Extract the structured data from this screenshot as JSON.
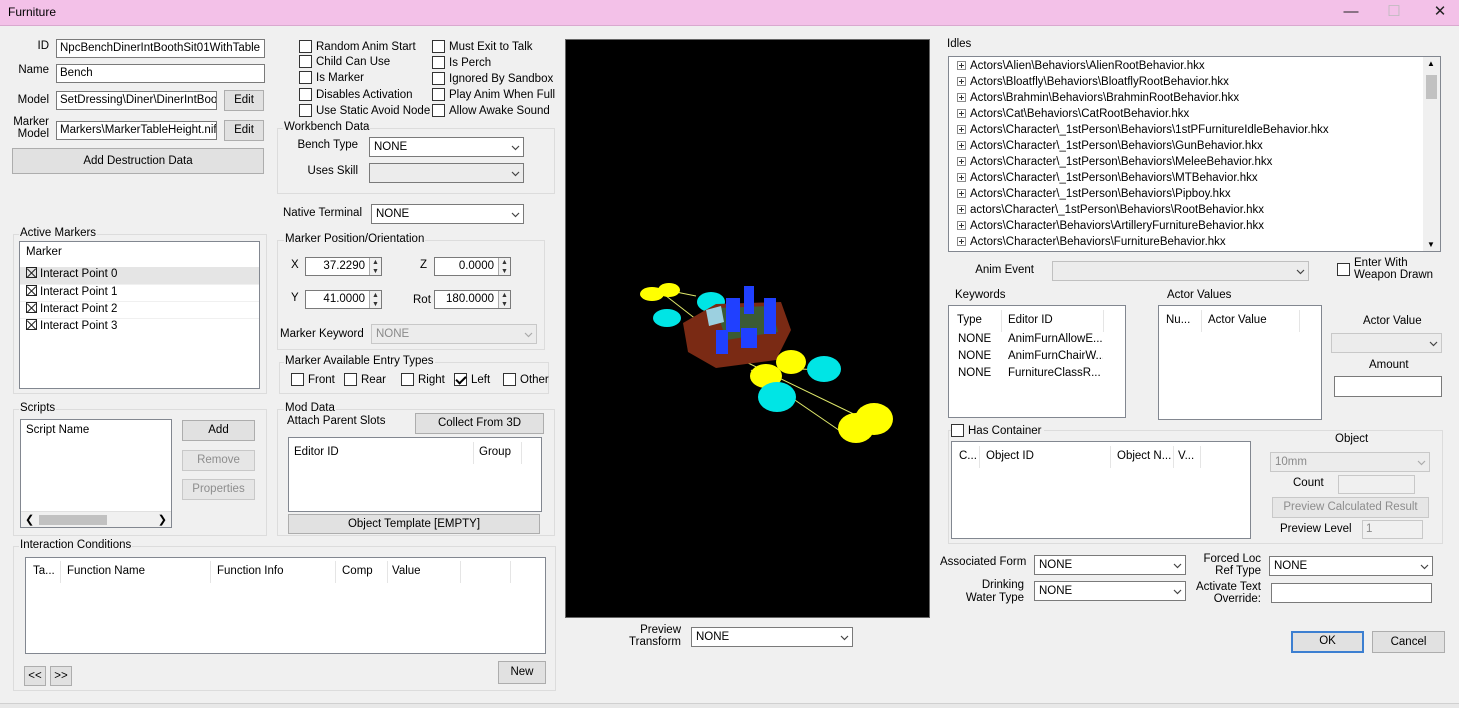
{
  "window": {
    "title": "Furniture"
  },
  "form": {
    "id_label": "ID",
    "id_value": "NpcBenchDinerIntBoothSit01WithTable",
    "name_label": "Name",
    "name_value": "Bench",
    "model_label": "Model",
    "model_value": "SetDressing\\Diner\\DinerIntBooth",
    "marker_model_label_1": "Marker",
    "marker_model_label_2": "Model",
    "marker_model_value": "Markers\\MarkerTableHeight.nif",
    "edit_label": "Edit",
    "add_destruction_label": "Add Destruction Data"
  },
  "flags": {
    "left": [
      {
        "label": "Random Anim Start",
        "checked": false
      },
      {
        "label": "Child Can Use",
        "checked": false
      },
      {
        "label": "Is Marker",
        "checked": false
      },
      {
        "label": "Disables Activation",
        "checked": false
      },
      {
        "label": "Use Static Avoid Node",
        "checked": false
      }
    ],
    "right": [
      {
        "label": "Must Exit to Talk",
        "checked": false
      },
      {
        "label": "Is Perch",
        "checked": false
      },
      {
        "label": "Ignored By Sandbox",
        "checked": false
      },
      {
        "label": "Play Anim When Full",
        "checked": false
      },
      {
        "label": "Allow Awake Sound",
        "checked": false
      }
    ]
  },
  "workbench": {
    "title": "Workbench Data",
    "bench_type_label": "Bench Type",
    "bench_type_value": "NONE",
    "uses_skill_label": "Uses Skill",
    "uses_skill_value": "",
    "native_terminal_label": "Native Terminal",
    "native_terminal_value": "NONE"
  },
  "active_markers": {
    "title": "Active Markers",
    "header": "Marker",
    "items": [
      "Interact Point 0",
      "Interact Point 1",
      "Interact Point 2",
      "Interact Point 3"
    ]
  },
  "marker_position": {
    "title": "Marker Position/Orientation",
    "x_label": "X",
    "x_value": "37.2290",
    "y_label": "Y",
    "y_value": "41.0000",
    "z_label": "Z",
    "z_value": "0.0000",
    "rot_label": "Rot",
    "rot_value": "180.0000",
    "keyword_label": "Marker Keyword",
    "keyword_value": "NONE"
  },
  "entry_types": {
    "title": "Marker Available Entry Types",
    "items": [
      {
        "label": "Front",
        "checked": false
      },
      {
        "label": "Rear",
        "checked": false
      },
      {
        "label": "Right",
        "checked": false
      },
      {
        "label": "Left",
        "checked": true
      },
      {
        "label": "Other",
        "checked": false
      }
    ]
  },
  "scripts": {
    "title": "Scripts",
    "header": "Script Name",
    "add": "Add",
    "remove": "Remove",
    "properties": "Properties"
  },
  "mod_data": {
    "title": "Mod Data",
    "attach_label": "Attach Parent Slots",
    "collect_label": "Collect From 3D",
    "headers": [
      "Editor ID",
      "Group"
    ],
    "object_template_label": "Object Template [EMPTY]"
  },
  "interaction_conditions": {
    "title": "Interaction Conditions",
    "headers": [
      "Ta...",
      "Function Name",
      "Function Info",
      "Comp",
      "Value"
    ],
    "prev_label": "<<",
    "next_label": ">>",
    "new_label": "New"
  },
  "preview": {
    "transform_label_1": "Preview",
    "transform_label_2": "Transform",
    "transform_value": "NONE"
  },
  "idles": {
    "title": "Idles",
    "items": [
      "Actors\\Alien\\Behaviors\\AlienRootBehavior.hkx",
      "Actors\\Bloatfly\\Behaviors\\BloatflyRootBehavior.hkx",
      "Actors\\Brahmin\\Behaviors\\BrahminRootBehavior.hkx",
      "Actors\\Cat\\Behaviors\\CatRootBehavior.hkx",
      "Actors\\Character\\_1stPerson\\Behaviors\\1stPFurnitureIdleBehavior.hkx",
      "Actors\\Character\\_1stPerson\\Behaviors\\GunBehavior.hkx",
      "Actors\\Character\\_1stPerson\\Behaviors\\MeleeBehavior.hkx",
      "Actors\\Character\\_1stPerson\\Behaviors\\MTBehavior.hkx",
      "Actors\\Character\\_1stPerson\\Behaviors\\Pipboy.hkx",
      "actors\\Character\\_1stPerson\\Behaviors\\RootBehavior.hkx",
      "Actors\\Character\\Behaviors\\ArtilleryFurnitureBehavior.hkx",
      "Actors\\Character\\Behaviors\\FurnitureBehavior.hkx"
    ],
    "anim_event_label": "Anim Event",
    "anim_event_value": "",
    "enter_weapon_label_1": "Enter With",
    "enter_weapon_label_2": "Weapon Drawn"
  },
  "keywords": {
    "title": "Keywords",
    "headers": [
      "Type",
      "Editor ID"
    ],
    "rows": [
      [
        "NONE",
        "AnimFurnAllowE..."
      ],
      [
        "NONE",
        "AnimFurnChairW..."
      ],
      [
        "NONE",
        "FurnitureClassR..."
      ]
    ]
  },
  "actor_values": {
    "title": "Actor Values",
    "headers": [
      "Nu...",
      "Actor Value"
    ],
    "actor_value_label": "Actor Value",
    "actor_value_value": "",
    "amount_label": "Amount",
    "amount_value": ""
  },
  "container": {
    "has_container_label": "Has Container",
    "headers": [
      "C...",
      "Object ID",
      "Object N...",
      "V..."
    ],
    "object_label": "Object",
    "object_value": "10mm",
    "count_label": "Count",
    "count_value": "",
    "preview_calc_label": "Preview Calculated Result",
    "preview_level_label": "Preview Level",
    "preview_level_value": "1"
  },
  "bottom_right": {
    "associated_form_label": "Associated Form",
    "associated_form_value": "NONE",
    "drinking_label_1": "Drinking",
    "drinking_label_2": "Water Type",
    "drinking_value": "NONE",
    "forced_loc_label_1": "Forced Loc",
    "forced_loc_label_2": "Ref Type",
    "forced_loc_value": "NONE",
    "activate_label_1": "Activate Text",
    "activate_label_2": "Override:",
    "activate_value": "",
    "ok": "OK",
    "cancel": "Cancel"
  }
}
